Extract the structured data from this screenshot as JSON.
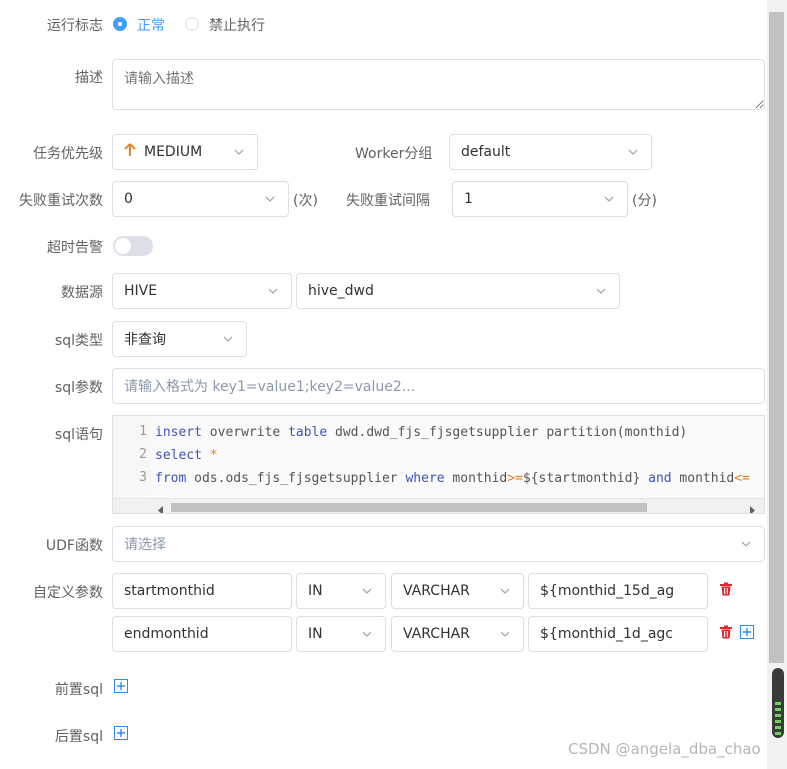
{
  "run_flag": {
    "label": "运行标志",
    "option_normal": "正常",
    "option_forbidden": "禁止执行",
    "selected": "正常"
  },
  "description": {
    "label": "描述",
    "placeholder": "请输入描述"
  },
  "priority": {
    "label": "任务优先级",
    "value": "MEDIUM",
    "icon": "arrow-up-icon",
    "color": "#e6822e"
  },
  "worker_group": {
    "label": "Worker分组",
    "value": "default"
  },
  "retry_times": {
    "label": "失败重试次数",
    "value": "0",
    "unit": "(次)"
  },
  "retry_interval": {
    "label": "失败重试间隔",
    "value": "1",
    "unit": "(分)"
  },
  "timeout_alarm": {
    "label": "超时告警",
    "enabled": false
  },
  "datasource": {
    "label": "数据源",
    "type": "HIVE",
    "name": "hive_dwd"
  },
  "sql_type": {
    "label": "sql类型",
    "value": "非查询"
  },
  "sql_params": {
    "label": "sql参数",
    "placeholder": "请输入格式为 key1=value1;key2=value2..."
  },
  "sql_statement": {
    "label": "sql语句",
    "line_numbers": [
      "1",
      "2",
      "3"
    ],
    "line1": {
      "kw1": "insert",
      "t1": " overwrite ",
      "kw2": "table",
      "t2": " dwd.dwd_fjs_fjsgetsupplier partition(monthid)"
    },
    "line2": {
      "kw1": "select",
      "op1": " *"
    },
    "line3": {
      "kw1": "from",
      "t1": " ods.ods_fjs_fjsgetsupplier ",
      "kw2": "where",
      "t2": " monthid",
      "op1": ">=",
      "t3": "${startmonthid} ",
      "kw3": "and",
      "t4": " monthid",
      "op2": "<="
    }
  },
  "udf": {
    "label": "UDF函数",
    "placeholder": "请选择"
  },
  "custom_params": {
    "label": "自定义参数",
    "rows": [
      {
        "prop": "startmonthid",
        "direct": "IN",
        "type": "VARCHAR",
        "value": "${monthid_15d_ag"
      },
      {
        "prop": "endmonthid",
        "direct": "IN",
        "type": "VARCHAR",
        "value": "${monthid_1d_agc"
      }
    ]
  },
  "pre_sql": {
    "label": "前置sql"
  },
  "post_sql": {
    "label": "后置sql"
  },
  "watermark": "CSDN @angela_dba_chao",
  "colors": {
    "accent": "#409eff",
    "delete": "#f56c6c",
    "border": "#dcdfe6"
  }
}
